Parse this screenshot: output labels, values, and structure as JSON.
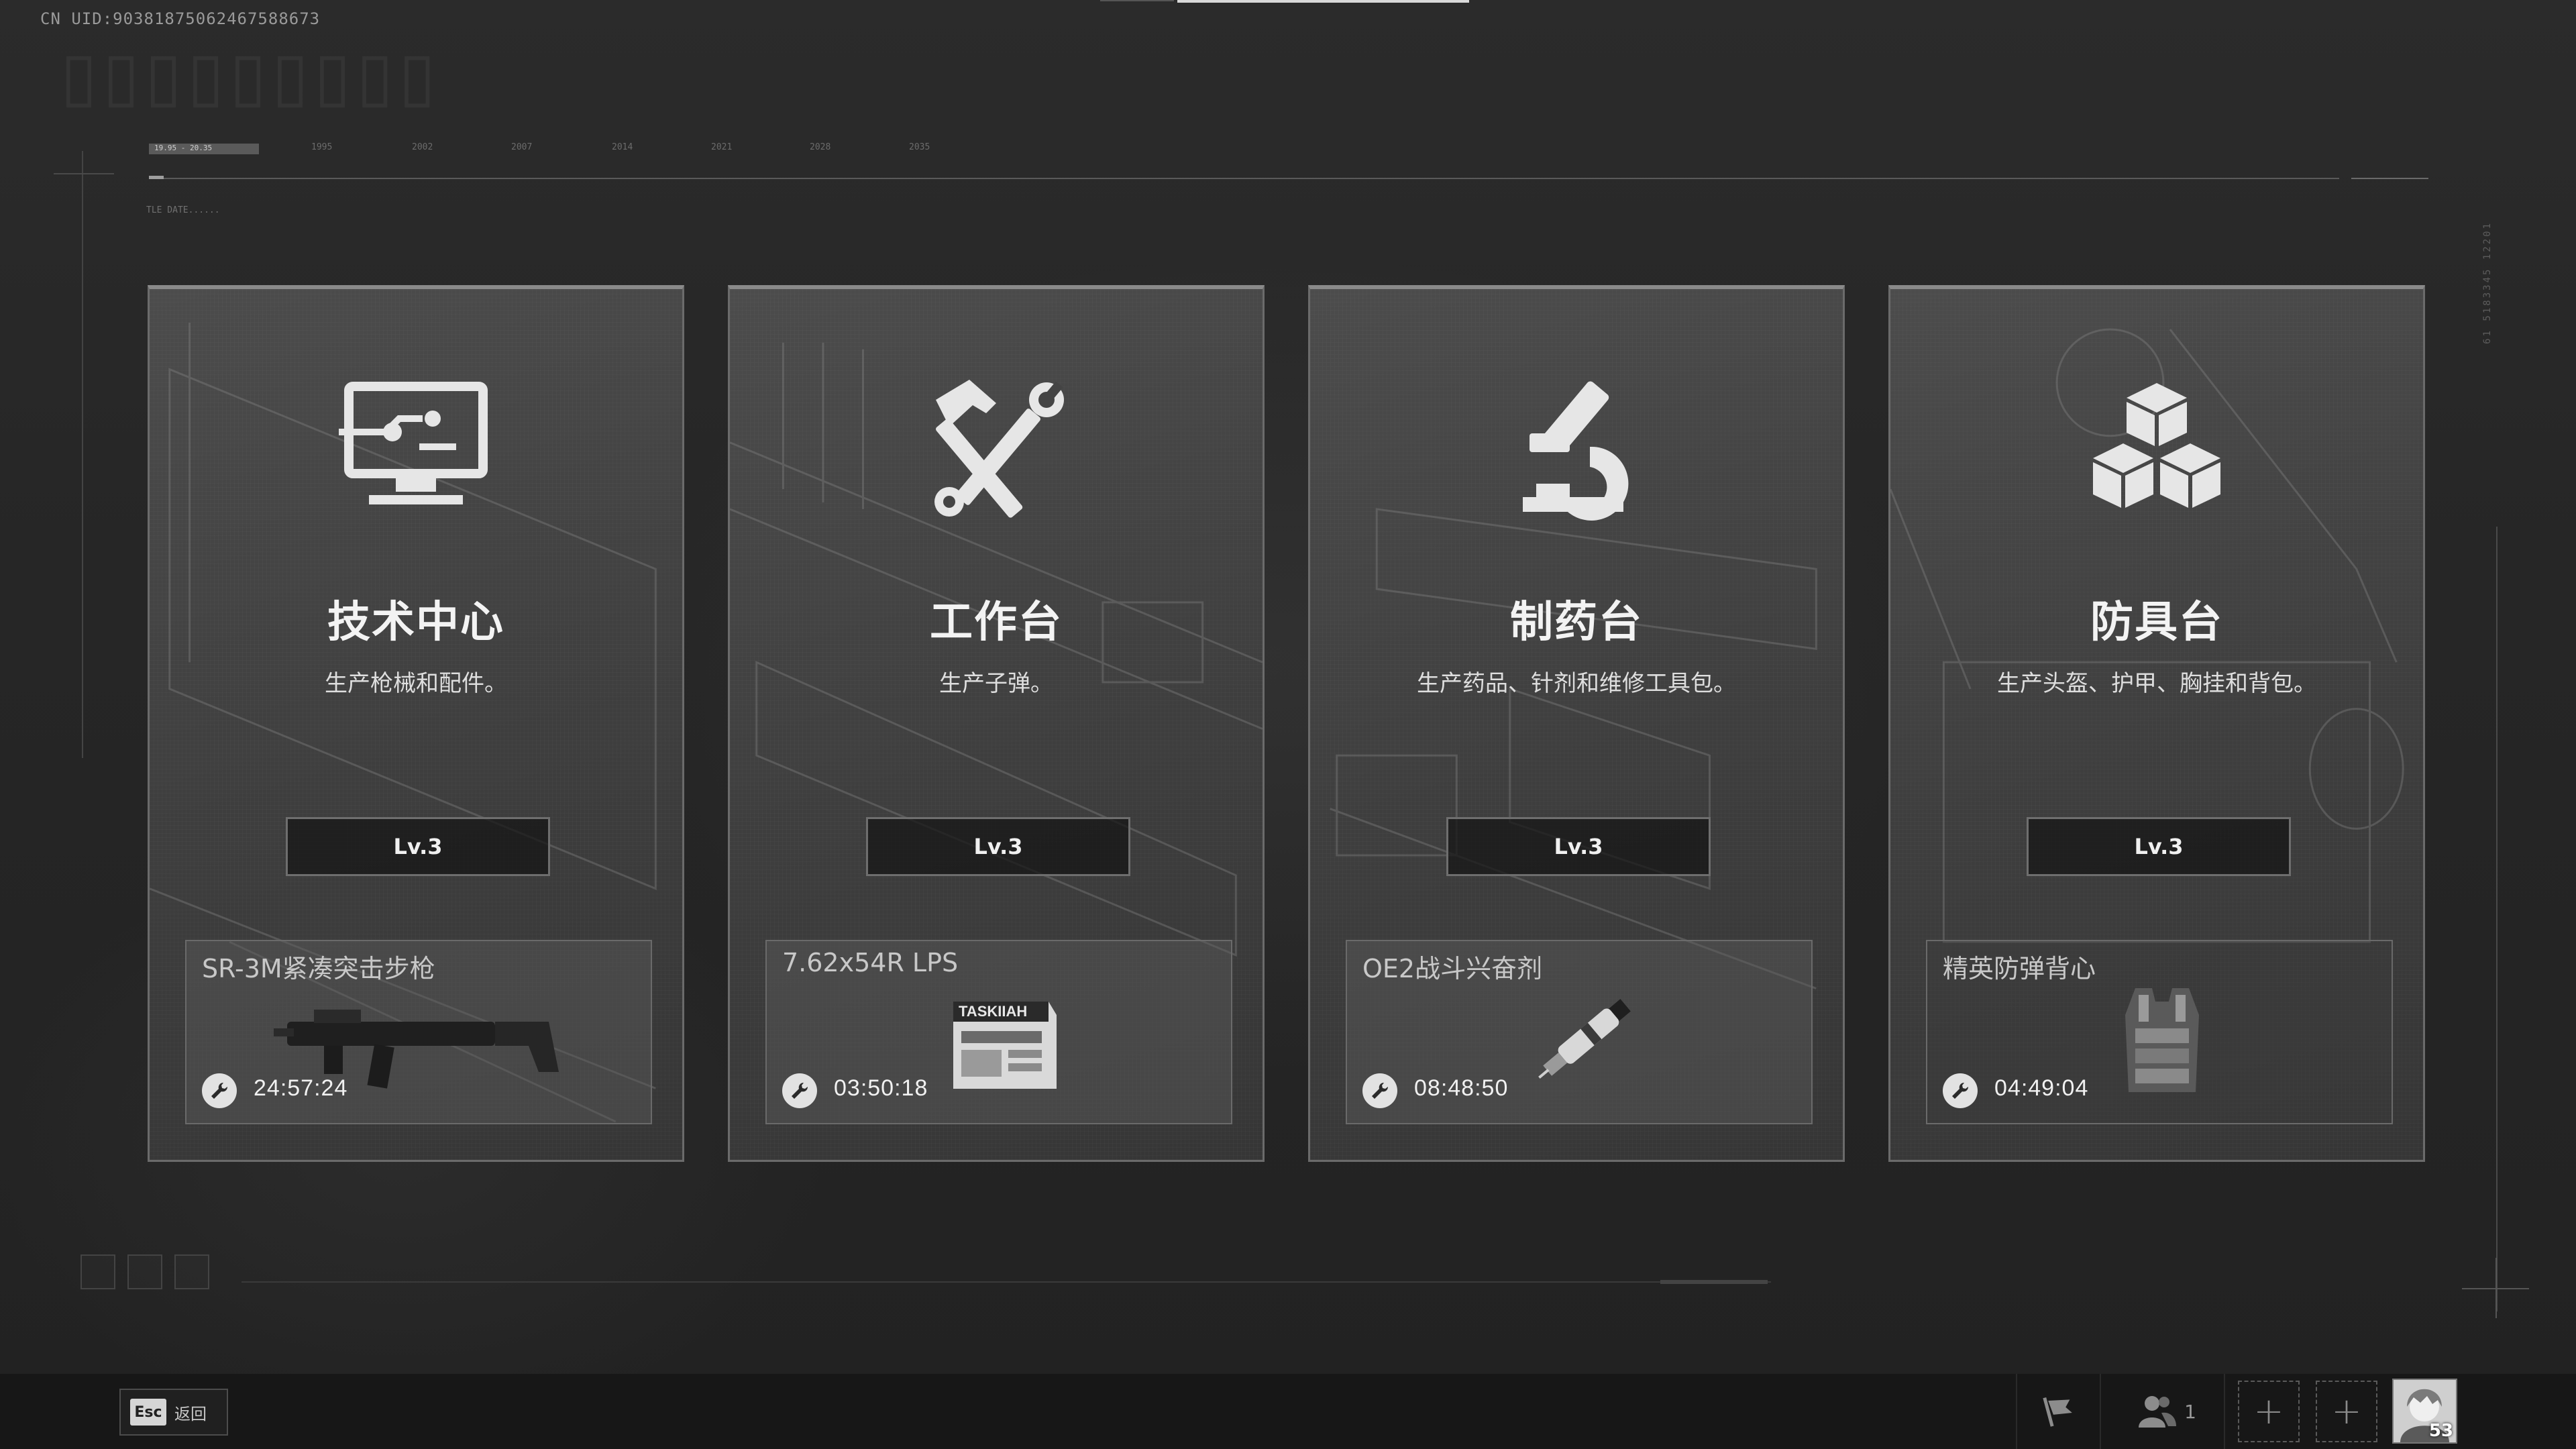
{
  "header": {
    "uid": "CN UID:9038187506246758867З",
    "timeline_range": "19.95 - 20.35",
    "timeline_years": [
      "1995",
      "2002",
      "2007",
      "2014",
      "2021",
      "2028",
      "2035"
    ],
    "note": "TLE DATE......"
  },
  "decor": {
    "side_code": "61 5183345 12201"
  },
  "workstations": [
    {
      "id": "tech-center",
      "icon": "monitor-circuit-icon",
      "title": "技术中心",
      "subtitle": "生产枪械和配件。",
      "level": "Lv.3",
      "crafting": {
        "item": "SR-3M紧凑突击步枪",
        "item_icon": "rifle-icon",
        "timer": "24:57:24"
      }
    },
    {
      "id": "workbench",
      "icon": "hammer-wrench-icon",
      "title": "工作台",
      "subtitle": "生产子弹。",
      "level": "Lv.3",
      "crafting": {
        "item": "7.62x54R LPS",
        "item_icon": "ammo-box-icon",
        "box_label": "TASKIIAH",
        "timer": "03:50:18"
      }
    },
    {
      "id": "pharmacy",
      "icon": "microscope-icon",
      "title": "制药台",
      "subtitle": "生产药品、针剂和维修工具包。",
      "level": "Lv.3",
      "crafting": {
        "item": "OE2战斗兴奋剂",
        "item_icon": "injector-icon",
        "timer": "08:48:50"
      }
    },
    {
      "id": "armor-bench",
      "icon": "cubes-icon",
      "title": "防具台",
      "subtitle": "生产头盔、护甲、胸挂和背包。",
      "level": "Lv.3",
      "crafting": {
        "item": "精英防弹背心",
        "item_icon": "vest-icon",
        "timer": "04:49:04"
      }
    }
  ],
  "bottom_bar": {
    "back_key": "Esc",
    "back_label": "返回",
    "flag_icon": "flag-icon",
    "squad_icon": "squad-members-icon",
    "squad_count": "1",
    "slot_symbol": "+",
    "avatar_icon": "player-avatar",
    "player_level": "53"
  },
  "colors": {
    "background": "#262626",
    "card": "#444444",
    "card_border": "#6b6b6b",
    "text": "#f3f3f3"
  }
}
